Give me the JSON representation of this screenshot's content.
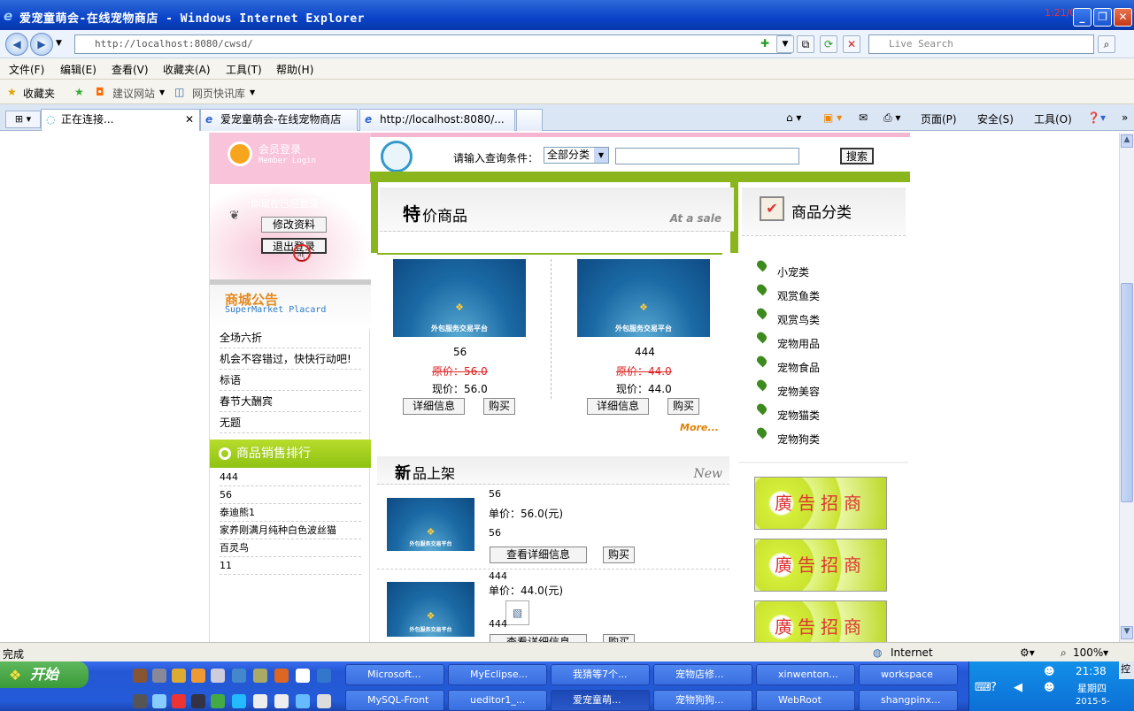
{
  "window": {
    "title": "爱宠童萌会-在线宠物商店 - Windows Internet Explorer",
    "corner_text": "1:21/0:15"
  },
  "address": {
    "url": "http://localhost:8080/cwsd/",
    "search_placeholder": "Live Search"
  },
  "menu": [
    "文件(F)",
    "编辑(E)",
    "查看(V)",
    "收藏夹(A)",
    "工具(T)",
    "帮助(H)"
  ],
  "favorites": {
    "label": "收藏夹",
    "suggested": "建议网站",
    "webslice": "网页快讯库"
  },
  "tabs": [
    "正在连接...",
    "爱宠童萌会-在线宠物商店",
    "http://localhost:8080/..."
  ],
  "tabtools": {
    "page": "页面(P)",
    "safety": "安全(S)",
    "tools": "工具(O)"
  },
  "site": {
    "login": {
      "title": "会员登录",
      "subtitle": "Member Login",
      "overlay_text": "你现在已经登录",
      "modify": "修改资料",
      "logout": "退出登录"
    },
    "search": {
      "label": "请输入查询条件：",
      "category": "全部分类",
      "button": "搜索"
    },
    "notice": {
      "title": "商城公告",
      "subtitle": "SuperMarket Placard",
      "items": [
        "全场六折",
        "机会不容错过，快快行动吧!",
        "标语",
        "春节大酬宾",
        "无题"
      ]
    },
    "sales": {
      "title": "商品销售排行",
      "items": [
        "444",
        "56",
        "泰迪熊1",
        "家养刚满月纯种白色波丝猫",
        "百灵鸟",
        "11"
      ]
    },
    "special": {
      "title_big": "特",
      "title_rest": "价商品",
      "tag": "At a sale",
      "more": "More...",
      "products": [
        {
          "name": "56",
          "orig": "原价：56.0",
          "now": "现价：56.0",
          "detail": "详细信息",
          "buy": "购买",
          "img_text": "外包服务交易平台"
        },
        {
          "name": "444",
          "orig": "原价：44.0",
          "now": "现价：44.0",
          "detail": "详细信息",
          "buy": "购买",
          "img_text": "外包服务交易平台"
        }
      ]
    },
    "newprod": {
      "title_big": "新",
      "title_rest": "品上架",
      "tag": "New",
      "items": [
        {
          "name": "56",
          "price": "单价：56.0(元)",
          "desc": "56",
          "detail": "查看详细信息",
          "buy": "购买",
          "img_text": "外包服务交易平台"
        },
        {
          "name": "444",
          "price": "单价：44.0(元)",
          "desc": "444",
          "detail": "查看详细信息",
          "buy": "购买",
          "img_text": "外包服务交易平台"
        }
      ]
    },
    "category": {
      "title": "商品分类",
      "items": [
        "小宠类",
        "观赏鱼类",
        "观赏鸟类",
        "宠物用品",
        "宠物食品",
        "宠物美容",
        "宠物猫类",
        "宠物狗类"
      ]
    },
    "ads": [
      "廣告招商",
      "廣告招商",
      "廣告招商"
    ]
  },
  "status": {
    "text": "完成",
    "zone": "Internet",
    "zoom": "100%"
  },
  "taskbar": {
    "start": "开始",
    "row1": [
      "Microsoft...",
      "MyEclipse...",
      "我猜等7个...",
      "宠物店修...",
      "xinwenton...",
      "workspace"
    ],
    "row2": [
      "MySQL-Front",
      "ueditor1_...",
      "爱宠童萌...",
      "宠物狗狗...",
      "WebRoot",
      "shangpinx..."
    ],
    "time": "21:38",
    "weekday": "星期四",
    "date": "2015-5-",
    "side": "控"
  }
}
